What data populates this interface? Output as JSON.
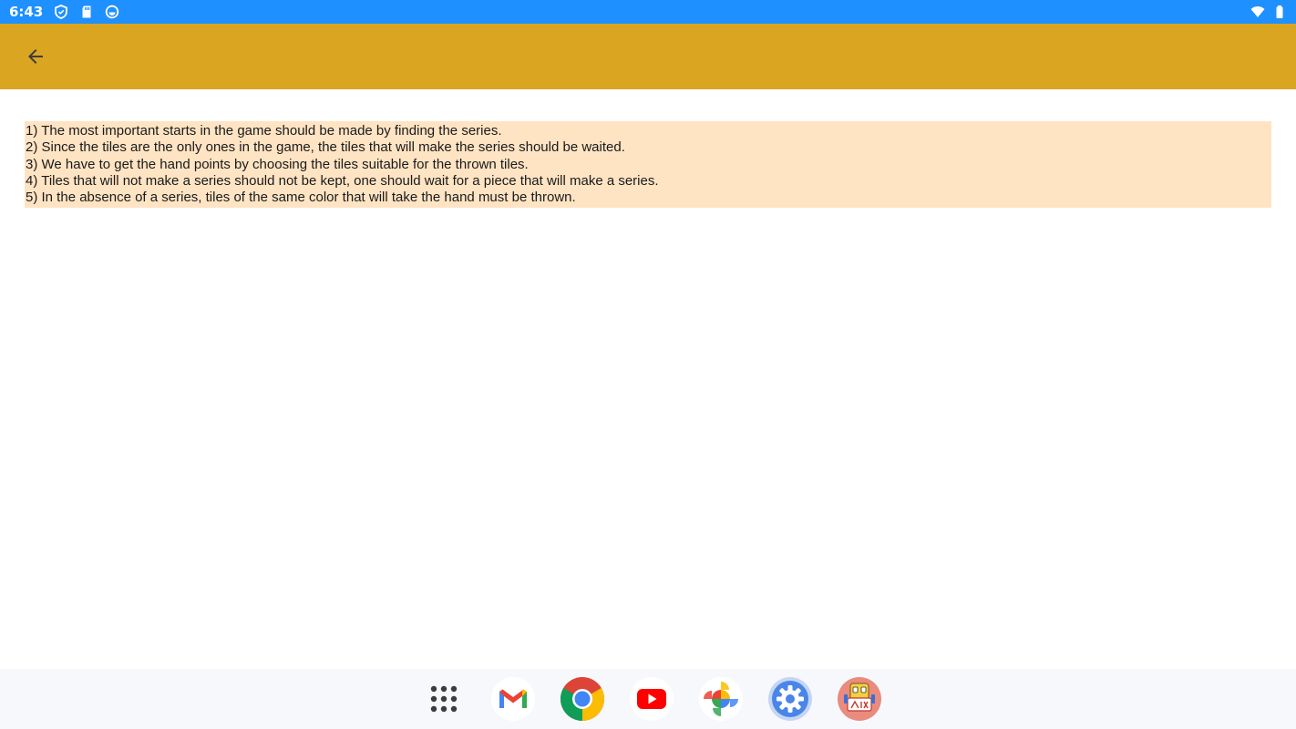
{
  "colors": {
    "status_bar": "#1E90FF",
    "app_bar": "#DAA520",
    "rules_background": "#FFE4C4",
    "taskbar": "#F7F8FC",
    "icon_dark": "#3d3d3d"
  },
  "status_bar": {
    "time": "6:43",
    "left_icons": [
      "shield-icon",
      "sd-card-icon",
      "sync-icon"
    ],
    "right_icons": [
      "wifi-icon",
      "battery-icon"
    ]
  },
  "app_bar": {
    "back_icon": "arrow-back-icon"
  },
  "rules": [
    "1) The most important starts in the game should be made by finding the series.",
    "2) Since the tiles are the only ones in the game, the tiles that will make the series should be waited.",
    "3) We have to get the hand points by choosing the tiles suitable for the thrown tiles.",
    "4) Tiles that will not make a series should not be kept, one should wait for a piece that will make a series.",
    "5) In the absence of a series, tiles of the same color that will take the hand must be thrown."
  ],
  "taskbar": {
    "apps": [
      "all-apps-icon",
      "gmail-icon",
      "chrome-icon",
      "youtube-icon",
      "photos-icon",
      "settings-icon",
      "okey-game-icon"
    ]
  }
}
